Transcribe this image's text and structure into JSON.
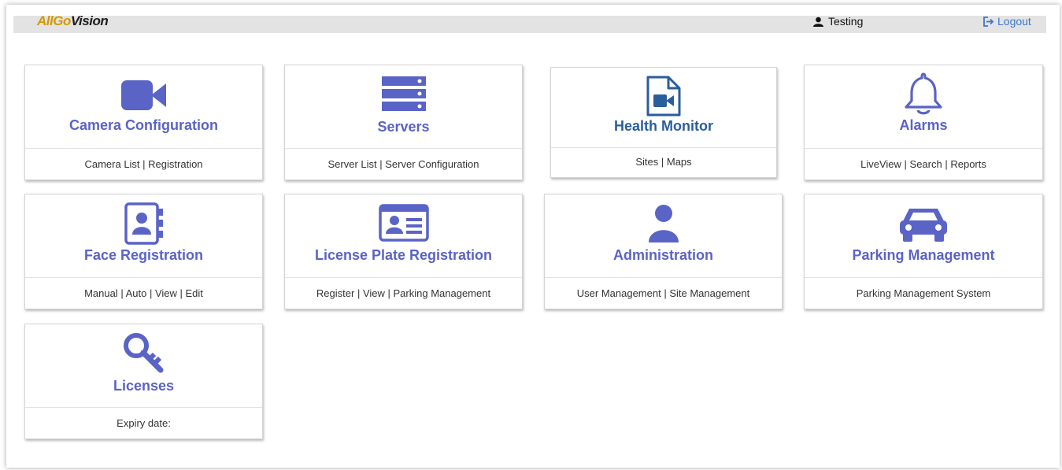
{
  "header": {
    "logo_part1": "AllGo",
    "logo_part2": "Vision",
    "username": "Testing",
    "logout_label": "Logout"
  },
  "tiles": [
    {
      "title": "Camera Configuration",
      "icon": "video-camera-icon",
      "links": [
        "Camera List",
        "Registration"
      ]
    },
    {
      "title": "Servers",
      "icon": "server-icon",
      "links": [
        "Server List",
        "Server Configuration"
      ]
    },
    {
      "title": "Health Monitor",
      "icon": "video-file-icon",
      "links": [
        "Sites",
        "Maps"
      ]
    },
    {
      "title": "Alarms",
      "icon": "bell-icon",
      "links": [
        "LiveView",
        "Search",
        "Reports"
      ]
    },
    {
      "title": "Face Registration",
      "icon": "contact-book-icon",
      "links": [
        "Manual",
        "Auto",
        "View",
        "Edit"
      ]
    },
    {
      "title": "License Plate Registration",
      "icon": "id-card-icon",
      "links": [
        "Register",
        "View",
        "Parking Management"
      ]
    },
    {
      "title": "Administration",
      "icon": "user-icon",
      "links": [
        "User Management",
        "Site Management"
      ]
    },
    {
      "title": "Parking Management",
      "icon": "car-icon",
      "links": [
        "Parking Management System"
      ]
    },
    {
      "title": "Licenses",
      "icon": "key-icon",
      "links": [
        "Expiry date:"
      ]
    }
  ],
  "colors": {
    "accent": "#5a63c6",
    "accent_dark": "#2a5d9c",
    "topbar": "#e3e3e3",
    "logo_gold": "#d29a00"
  }
}
